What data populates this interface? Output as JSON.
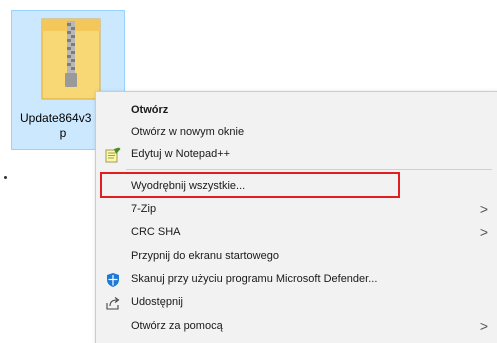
{
  "file": {
    "name_line1": "Update864v3",
    "name_line2": "p"
  },
  "context_menu": {
    "items": [
      {
        "label": "Otwórz",
        "icon": "",
        "submenu": false
      },
      {
        "label": "Otwórz w nowym oknie",
        "icon": "",
        "submenu": false
      },
      {
        "label": "Edytuj w Notepad++",
        "icon": "notepad-plus-plus-icon",
        "submenu": false
      },
      {
        "label": "Wyodrębnij wszystkie...",
        "icon": "",
        "submenu": false
      },
      {
        "label": "7-Zip",
        "icon": "",
        "submenu": true
      },
      {
        "label": "CRC SHA",
        "icon": "",
        "submenu": true
      },
      {
        "label": "Przypnij do ekranu startowego",
        "icon": "",
        "submenu": false
      },
      {
        "label": "Skanuj przy użyciu programu Microsoft Defender...",
        "icon": "defender-shield-icon",
        "submenu": false
      },
      {
        "label": "Udostępnij",
        "icon": "share-icon",
        "submenu": false
      },
      {
        "label": "Otwórz za pomocą",
        "icon": "",
        "submenu": true
      }
    ],
    "submenu_arrow": ">"
  },
  "colors": {
    "selection_bg": "#cce8ff",
    "highlight_border": "#e02020",
    "menu_bg": "#f2f2f2"
  }
}
